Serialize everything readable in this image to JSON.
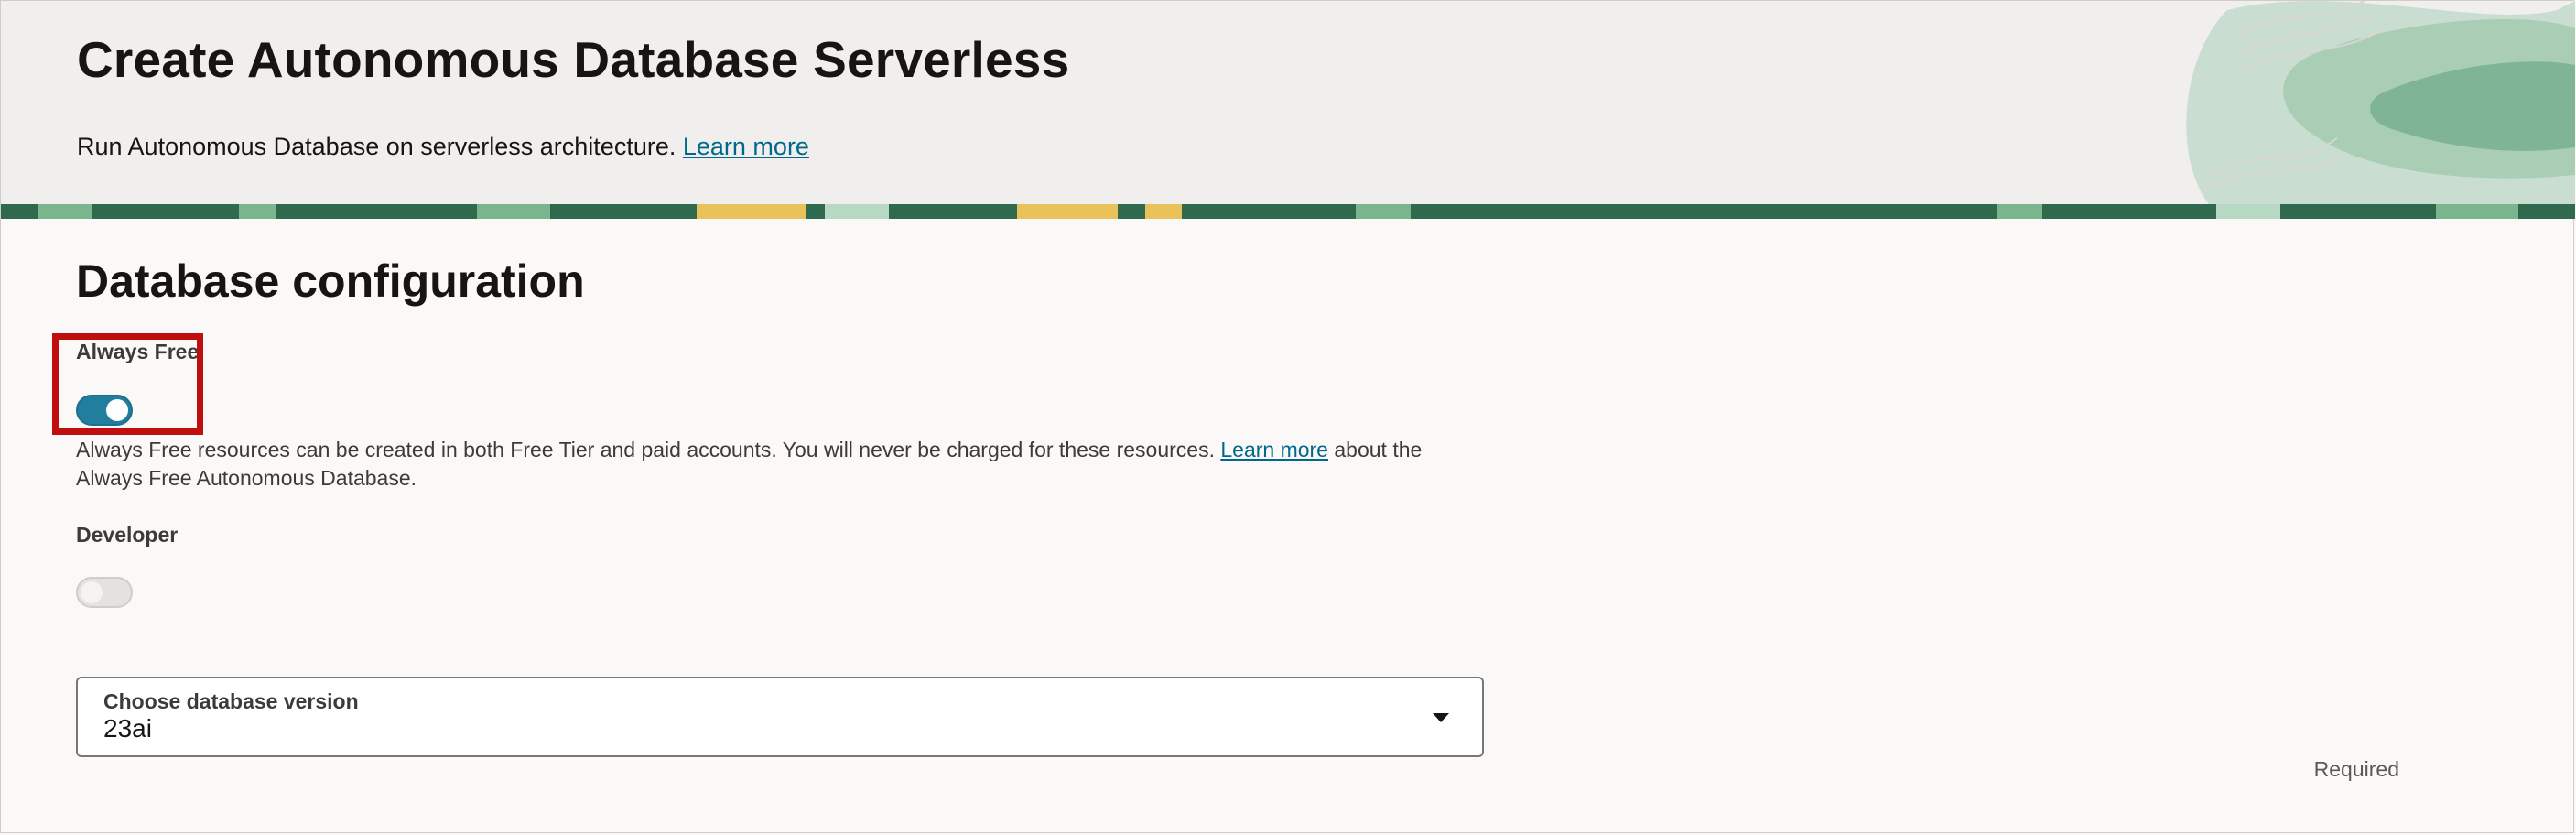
{
  "header": {
    "title": "Create Autonomous Database Serverless",
    "subtitle": "Run Autonomous Database on serverless architecture.",
    "learn_more": "Learn more"
  },
  "section": {
    "title": "Database configuration"
  },
  "always_free": {
    "label": "Always Free",
    "enabled": true,
    "help_before": "Always Free resources can be created in both Free Tier and paid accounts. You will never be charged for these resources.",
    "help_link": "Learn more",
    "help_after": "about the Always Free Autonomous Database."
  },
  "developer": {
    "label": "Developer",
    "enabled": false
  },
  "db_version": {
    "label": "Choose database version",
    "value": "23ai",
    "required_text": "Required"
  },
  "colors": {
    "toggle_on": "#227e9e",
    "link": "#00688c",
    "highlight": "#c00f0f"
  }
}
